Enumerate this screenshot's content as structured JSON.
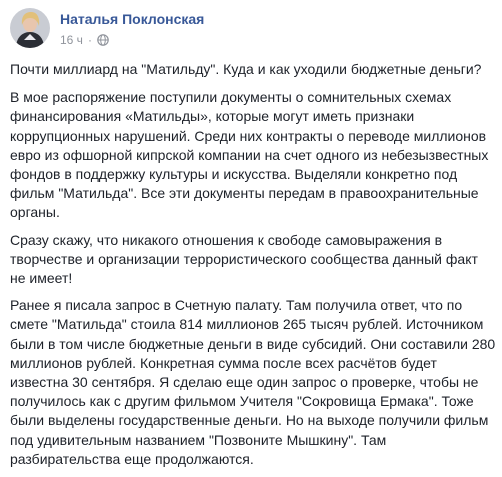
{
  "post": {
    "author": "Наталья Поклонская",
    "timestamp": "16 ч",
    "separator": "·",
    "privacy_icon": "globe-icon",
    "paragraphs": [
      "Почти миллиард на \"Матильду\". Куда и как уходили бюджетные деньги?",
      "В мое распоряжение поступили документы о сомнительных схемах финансирования «Матильды», которые могут иметь признаки коррупционных нарушений. Среди них контракты о переводе миллионов евро из офшорной кипрской компании на счет одного из небезызвестных фондов в поддержку культуры и искусства. Выделяли конкретно под фильм \"Матильда\". Все эти документы передам в правоохранительные органы.",
      "Сразу скажу, что никакого отношения к свободе самовыражения в творчестве и организации террористического сообщества данный факт не имеет!",
      "Ранее я писала запрос в Счетную палату. Там получила ответ, что по смете \"Матильда\" стоила 814 миллионов 265 тысяч рублей. Источником были в том числе бюджетные деньги в виде субсидий. Они составили 280 миллионов рублей. Конкретная сумма после всех расчётов будет известна 30 сентября. Я сделаю еще один запрос о проверке, чтобы не получилось как с другим фильмом Учителя \"Сокровища Ермака\". Тоже были выделены государственные деньги. Но на выходе получили фильм под удивительным названием \"Позвоните Мышкину\". Там разбирательства еще продолжаются."
    ]
  },
  "colors": {
    "author_link": "#385898",
    "body_text": "#1d2129",
    "meta_text": "#90949c",
    "background": "#ffffff"
  }
}
